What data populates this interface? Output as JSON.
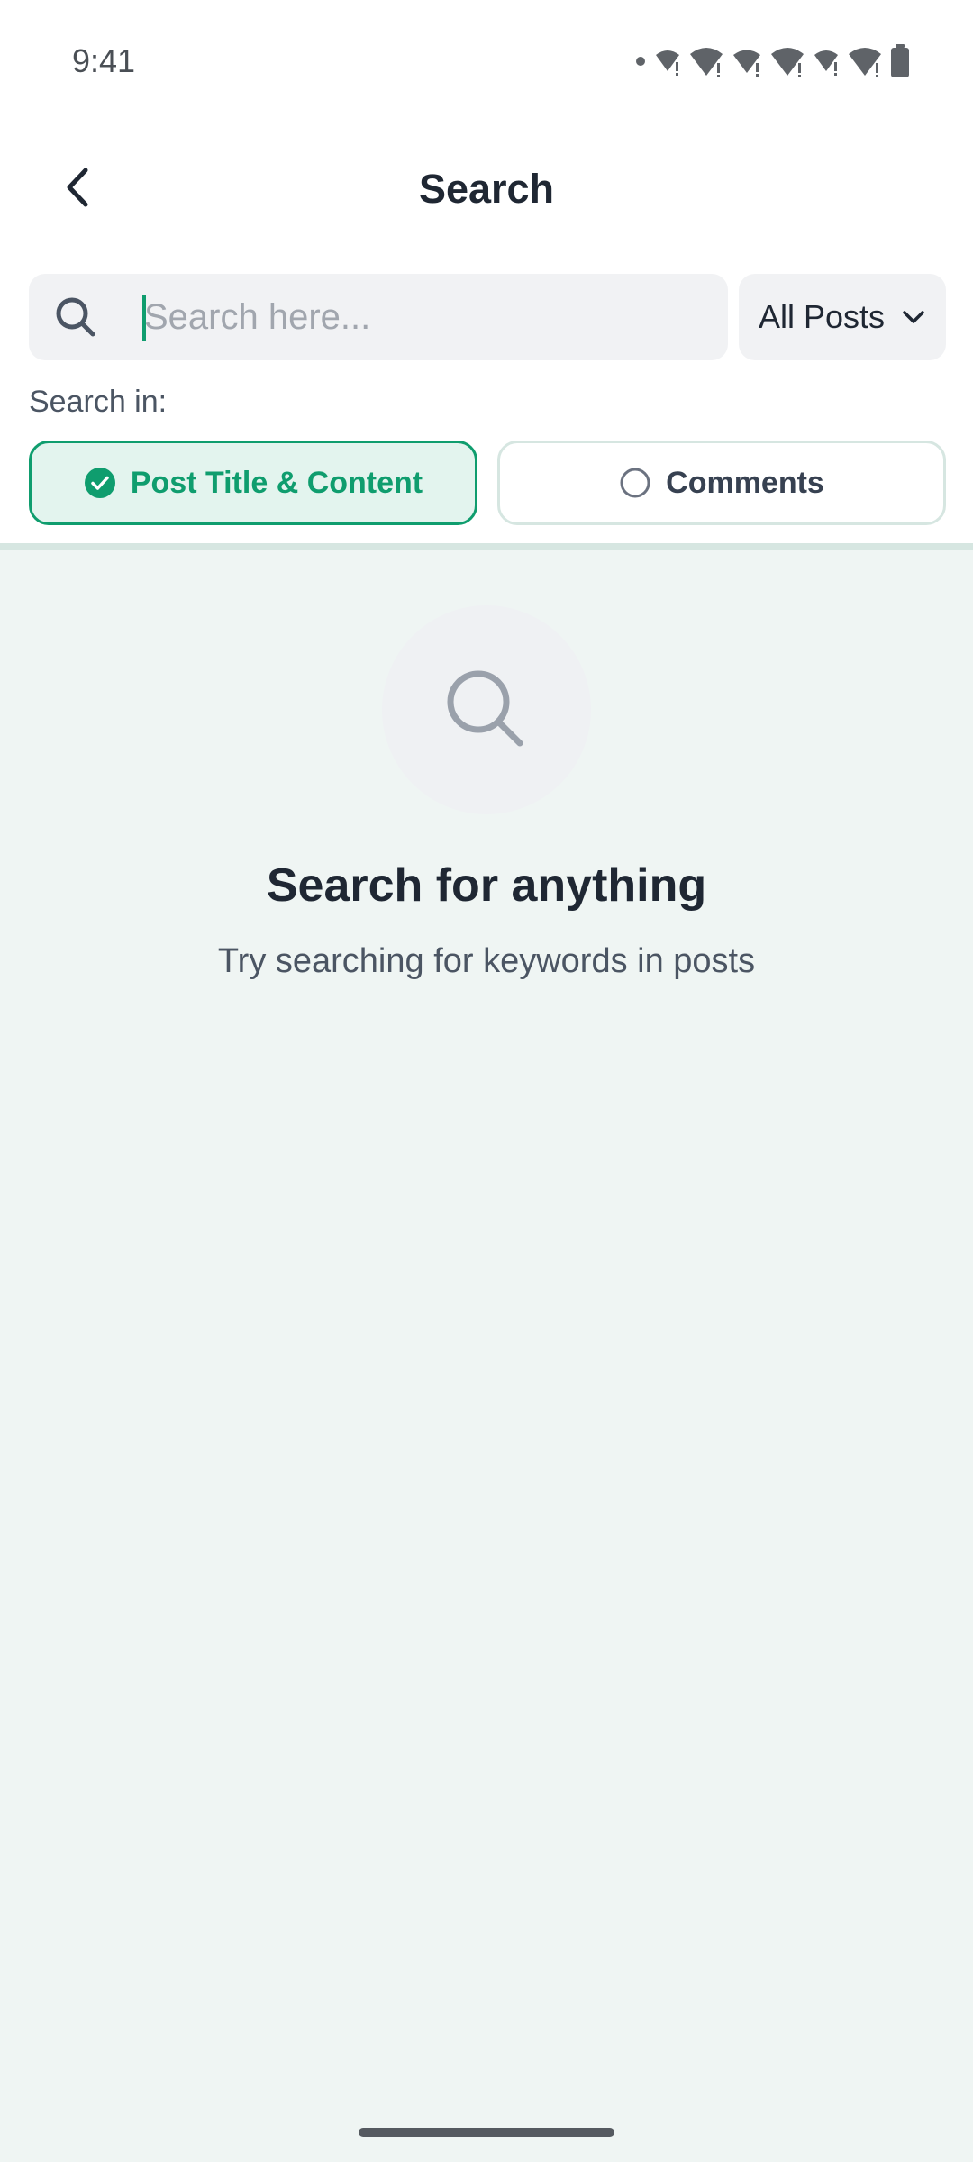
{
  "status_bar": {
    "time": "9:41"
  },
  "header": {
    "title": "Search",
    "back_icon": "chevron-left-icon"
  },
  "search": {
    "placeholder": "Search here...",
    "value": "",
    "icon": "search-icon"
  },
  "filter": {
    "selected": "All Posts",
    "icon": "chevron-down-icon"
  },
  "search_in": {
    "label": "Search in:",
    "options": [
      {
        "label": "Post Title & Content",
        "selected": true,
        "icon": "check-circle-icon"
      },
      {
        "label": "Comments",
        "selected": false,
        "icon": "radio-empty-icon"
      }
    ]
  },
  "empty_state": {
    "icon": "search-icon",
    "title": "Search for anything",
    "subtitle": "Try searching for keywords in posts"
  },
  "colors": {
    "accent": "#0f9d6e",
    "background": "#eff5f3",
    "text_primary": "#1f2733",
    "text_secondary": "#4b5563"
  }
}
